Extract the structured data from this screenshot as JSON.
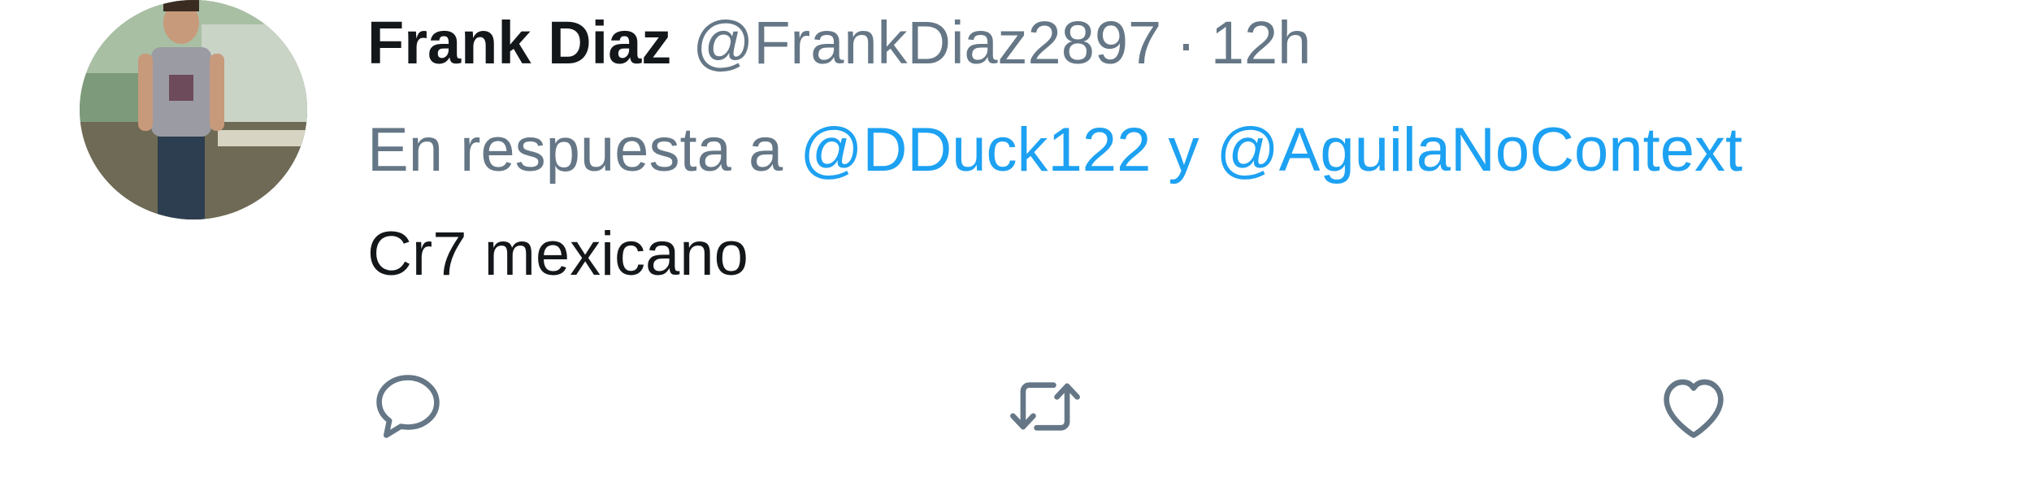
{
  "tweet": {
    "author": {
      "display_name": "Frank Diaz",
      "handle": "@FrankDiaz2897",
      "avatar_icon": "user-avatar-photo"
    },
    "separator": "·",
    "time": "12h",
    "reply_context": {
      "prefix": "En respuesta a",
      "mention_1": "@DDuck122",
      "conjunction": "y",
      "mention_2": "@AguilaNoContext"
    },
    "text": "Cr7 mexicano",
    "actions": [
      {
        "name": "reply",
        "icon": "reply-icon"
      },
      {
        "name": "retweet",
        "icon": "retweet-icon"
      },
      {
        "name": "like",
        "icon": "heart-icon"
      }
    ]
  },
  "colors": {
    "primary_text": "#14171a",
    "secondary_text": "#657786",
    "mention": "#1da1f2",
    "icon": "#657786"
  }
}
